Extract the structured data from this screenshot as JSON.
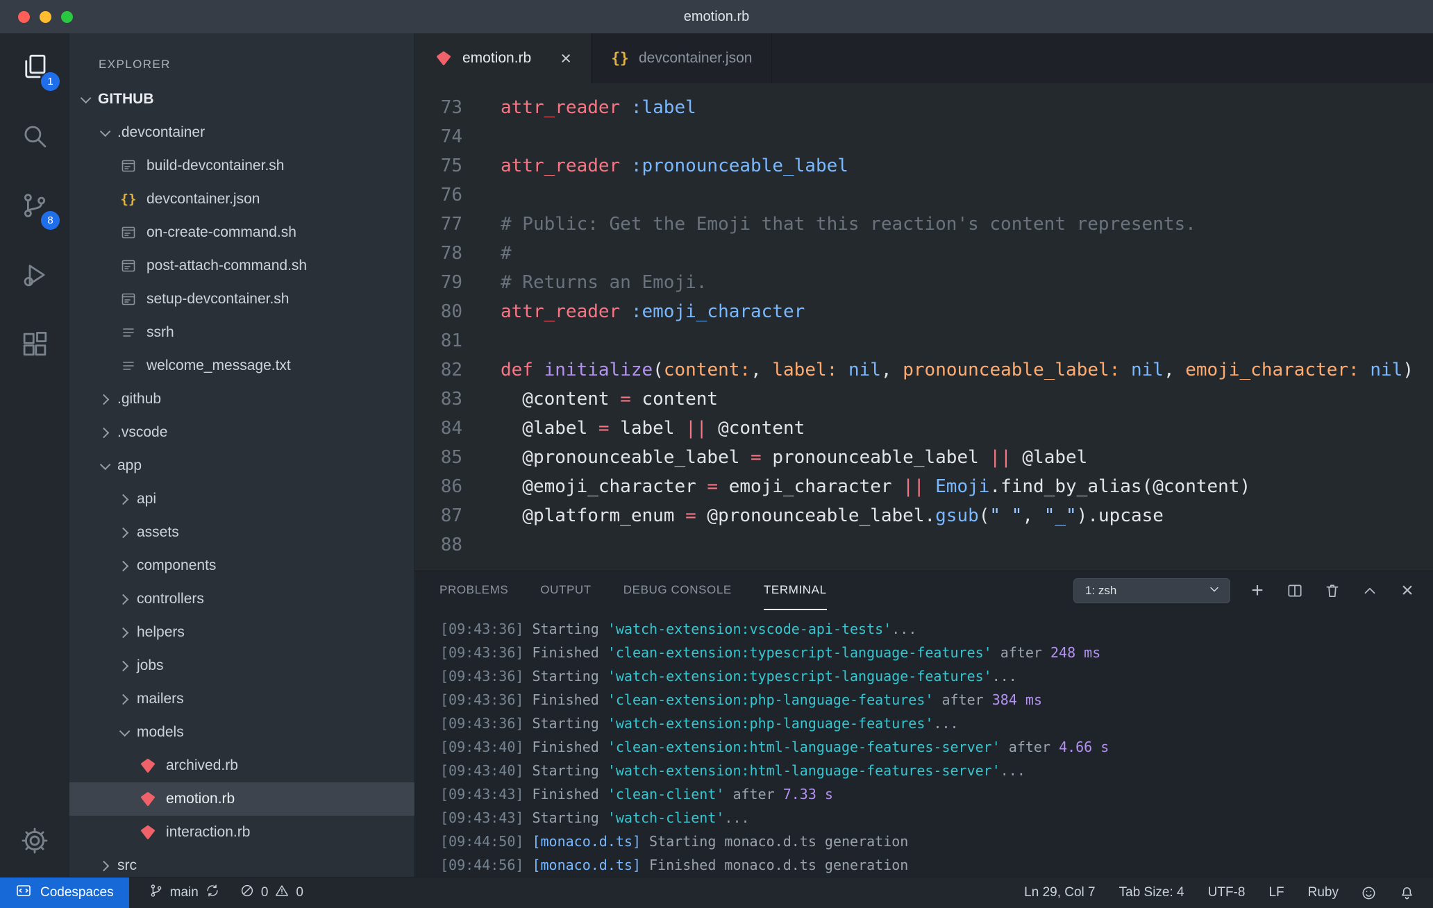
{
  "window": {
    "title": "emotion.rb"
  },
  "activity_bar": {
    "items": [
      {
        "id": "explorer",
        "badge": "1",
        "active": true
      },
      {
        "id": "search",
        "active": false
      },
      {
        "id": "source-control",
        "badge": "8",
        "active": false
      },
      {
        "id": "run-debug",
        "active": false
      },
      {
        "id": "extensions",
        "active": false
      }
    ],
    "settings_label": "settings"
  },
  "sidebar": {
    "header": "EXPLORER",
    "tree": [
      {
        "label": "GITHUB",
        "type": "root",
        "state": "expanded",
        "indent": 0
      },
      {
        "label": ".devcontainer",
        "type": "folder",
        "state": "expanded",
        "indent": 1
      },
      {
        "label": "build-devcontainer.sh",
        "type": "file",
        "icon": "shell",
        "indent": 2
      },
      {
        "label": "devcontainer.json",
        "type": "file",
        "icon": "json",
        "indent": 2
      },
      {
        "label": "on-create-command.sh",
        "type": "file",
        "icon": "shell",
        "indent": 2
      },
      {
        "label": "post-attach-command.sh",
        "type": "file",
        "icon": "shell",
        "indent": 2
      },
      {
        "label": "setup-devcontainer.sh",
        "type": "file",
        "icon": "shell",
        "indent": 2
      },
      {
        "label": "ssrh",
        "type": "file",
        "icon": "text",
        "indent": 2
      },
      {
        "label": "welcome_message.txt",
        "type": "file",
        "icon": "text",
        "indent": 2
      },
      {
        "label": ".github",
        "type": "folder",
        "state": "collapsed",
        "indent": 1
      },
      {
        "label": ".vscode",
        "type": "folder",
        "state": "collapsed",
        "indent": 1
      },
      {
        "label": "app",
        "type": "folder",
        "state": "expanded",
        "indent": 1
      },
      {
        "label": "api",
        "type": "folder",
        "state": "collapsed",
        "indent": 2
      },
      {
        "label": "assets",
        "type": "folder",
        "state": "collapsed",
        "indent": 2
      },
      {
        "label": "components",
        "type": "folder",
        "state": "collapsed",
        "indent": 2
      },
      {
        "label": "controllers",
        "type": "folder",
        "state": "collapsed",
        "indent": 2
      },
      {
        "label": "helpers",
        "type": "folder",
        "state": "collapsed",
        "indent": 2
      },
      {
        "label": "jobs",
        "type": "folder",
        "state": "collapsed",
        "indent": 2
      },
      {
        "label": "mailers",
        "type": "folder",
        "state": "collapsed",
        "indent": 2
      },
      {
        "label": "models",
        "type": "folder",
        "state": "expanded",
        "indent": 2
      },
      {
        "label": "archived.rb",
        "type": "file",
        "icon": "ruby",
        "indent": 3
      },
      {
        "label": "emotion.rb",
        "type": "file",
        "icon": "ruby",
        "indent": 3,
        "selected": true
      },
      {
        "label": "interaction.rb",
        "type": "file",
        "icon": "ruby",
        "indent": 3
      },
      {
        "label": "src",
        "type": "folder",
        "state": "collapsed",
        "indent": 1
      }
    ]
  },
  "tabs": [
    {
      "label": "emotion.rb",
      "icon": "ruby",
      "active": true,
      "close": "×"
    },
    {
      "label": "devcontainer.json",
      "icon": "json",
      "active": false
    }
  ],
  "editor": {
    "lines": [
      {
        "n": "73",
        "segs": [
          [
            "attr_reader",
            "r"
          ],
          [
            " ",
            "t"
          ],
          [
            ":label",
            "b"
          ]
        ]
      },
      {
        "n": "74",
        "segs": []
      },
      {
        "n": "75",
        "segs": [
          [
            "attr_reader",
            "r"
          ],
          [
            " ",
            "t"
          ],
          [
            ":pronounceable_label",
            "b"
          ]
        ]
      },
      {
        "n": "76",
        "segs": []
      },
      {
        "n": "77",
        "segs": [
          [
            "# Public: Get the Emoji that this reaction's content represents.",
            "c"
          ]
        ]
      },
      {
        "n": "78",
        "segs": [
          [
            "#",
            "c"
          ]
        ]
      },
      {
        "n": "79",
        "segs": [
          [
            "# Returns an Emoji.",
            "c"
          ]
        ]
      },
      {
        "n": "80",
        "segs": [
          [
            "attr_reader",
            "r"
          ],
          [
            " ",
            "t"
          ],
          [
            ":emoji_character",
            "b"
          ]
        ]
      },
      {
        "n": "81",
        "segs": []
      },
      {
        "n": "82",
        "segs": [
          [
            "def",
            "r"
          ],
          [
            " ",
            "t"
          ],
          [
            "initialize",
            "p"
          ],
          [
            "(",
            "t"
          ],
          [
            "content:",
            "o"
          ],
          [
            ", ",
            "t"
          ],
          [
            "label:",
            "o"
          ],
          [
            " ",
            "t"
          ],
          [
            "nil",
            "b"
          ],
          [
            ", ",
            "t"
          ],
          [
            "pronounceable_label:",
            "o"
          ],
          [
            " ",
            "t"
          ],
          [
            "nil",
            "b"
          ],
          [
            ", ",
            "t"
          ],
          [
            "emoji_character:",
            "o"
          ],
          [
            " ",
            "t"
          ],
          [
            "nil",
            "b"
          ],
          [
            ")",
            "t"
          ]
        ]
      },
      {
        "n": "83",
        "segs": [
          [
            "  @content ",
            "t"
          ],
          [
            "=",
            "r"
          ],
          [
            " content",
            "t"
          ]
        ]
      },
      {
        "n": "84",
        "segs": [
          [
            "  @label ",
            "t"
          ],
          [
            "=",
            "r"
          ],
          [
            " label ",
            "t"
          ],
          [
            "||",
            "r"
          ],
          [
            " @content",
            "t"
          ]
        ]
      },
      {
        "n": "85",
        "segs": [
          [
            "  @pronounceable_label ",
            "t"
          ],
          [
            "=",
            "r"
          ],
          [
            " pronounceable_label ",
            "t"
          ],
          [
            "||",
            "r"
          ],
          [
            " @label",
            "t"
          ]
        ]
      },
      {
        "n": "86",
        "segs": [
          [
            "  @emoji_character ",
            "t"
          ],
          [
            "=",
            "r"
          ],
          [
            " emoji_character ",
            "t"
          ],
          [
            "||",
            "r"
          ],
          [
            " ",
            "t"
          ],
          [
            "Emoji",
            "b"
          ],
          [
            ".find_by_alias(@content)",
            "t"
          ]
        ]
      },
      {
        "n": "87",
        "segs": [
          [
            "  @platform_enum ",
            "t"
          ],
          [
            "=",
            "r"
          ],
          [
            " @pronounceable_label.",
            "t"
          ],
          [
            "gsub",
            "b"
          ],
          [
            "(",
            "t"
          ],
          [
            "\" \"",
            "s"
          ],
          [
            ", ",
            "t"
          ],
          [
            "\"_\"",
            "s"
          ],
          [
            ")",
            "t"
          ],
          [
            ".upcase",
            "t"
          ]
        ]
      },
      {
        "n": "88",
        "segs": []
      }
    ]
  },
  "panel": {
    "tabs": [
      {
        "label": "PROBLEMS",
        "active": false
      },
      {
        "label": "OUTPUT",
        "active": false
      },
      {
        "label": "DEBUG CONSOLE",
        "active": false
      },
      {
        "label": "TERMINAL",
        "active": true
      }
    ],
    "terminal_selector": "1: zsh",
    "terminal_lines": [
      {
        "segs": [
          [
            "[09:43:36] ",
            "ts"
          ],
          [
            "Starting ",
            "t"
          ],
          [
            "'watch-extension:vscode-api-tests'",
            "cy"
          ],
          [
            "...",
            "t"
          ]
        ]
      },
      {
        "segs": [
          [
            "[09:43:36] ",
            "ts"
          ],
          [
            "Finished ",
            "t"
          ],
          [
            "'clean-extension:typescript-language-features'",
            "cy"
          ],
          [
            " after ",
            "t"
          ],
          [
            "248 ms",
            "pu"
          ]
        ]
      },
      {
        "segs": [
          [
            "[09:43:36] ",
            "ts"
          ],
          [
            "Starting ",
            "t"
          ],
          [
            "'watch-extension:typescript-language-features'",
            "cy"
          ],
          [
            "...",
            "t"
          ]
        ]
      },
      {
        "segs": [
          [
            "[09:43:36] ",
            "ts"
          ],
          [
            "Finished ",
            "t"
          ],
          [
            "'clean-extension:php-language-features'",
            "cy"
          ],
          [
            " after ",
            "t"
          ],
          [
            "384 ms",
            "pu"
          ]
        ]
      },
      {
        "segs": [
          [
            "[09:43:36] ",
            "ts"
          ],
          [
            "Starting ",
            "t"
          ],
          [
            "'watch-extension:php-language-features'",
            "cy"
          ],
          [
            "...",
            "t"
          ]
        ]
      },
      {
        "segs": [
          [
            "[09:43:40] ",
            "ts"
          ],
          [
            "Finished ",
            "t"
          ],
          [
            "'clean-extension:html-language-features-server'",
            "cy"
          ],
          [
            " after ",
            "t"
          ],
          [
            "4.66 s",
            "pu"
          ]
        ]
      },
      {
        "segs": [
          [
            "[09:43:40] ",
            "ts"
          ],
          [
            "Starting ",
            "t"
          ],
          [
            "'watch-extension:html-language-features-server'",
            "cy"
          ],
          [
            "...",
            "t"
          ]
        ]
      },
      {
        "segs": [
          [
            "[09:43:43] ",
            "ts"
          ],
          [
            "Finished ",
            "t"
          ],
          [
            "'clean-client'",
            "cy"
          ],
          [
            " after ",
            "t"
          ],
          [
            "7.33 s",
            "pu"
          ]
        ]
      },
      {
        "segs": [
          [
            "[09:43:43] ",
            "ts"
          ],
          [
            "Starting ",
            "t"
          ],
          [
            "'watch-client'",
            "cy"
          ],
          [
            "...",
            "t"
          ]
        ]
      },
      {
        "segs": [
          [
            "[09:44:50] ",
            "ts"
          ],
          [
            "[monaco.d.ts]",
            "bl"
          ],
          [
            " Starting monaco.d.ts generation",
            "t"
          ]
        ]
      },
      {
        "segs": [
          [
            "[09:44:56] ",
            "ts"
          ],
          [
            "[monaco.d.ts]",
            "bl"
          ],
          [
            " Finished monaco.d.ts generation",
            "t"
          ]
        ]
      }
    ]
  },
  "status_bar": {
    "codespaces": "Codespaces",
    "branch": "main",
    "errors": "0",
    "warnings": "0",
    "right_items": [
      "Ln 29, Col 7",
      "Tab Size: 4",
      "UTF-8",
      "LF",
      "Ruby"
    ]
  },
  "colors": {
    "badge_blue": "#1f6feb",
    "codespaces_blue": "#1669d6",
    "ruby_icon": "#f0626a",
    "json_icon": "#e3b341",
    "terminal_cyan": "#39c5cf",
    "terminal_purple": "#b392f0",
    "keyword_red": "#f97583",
    "symbol_blue": "#79b8ff",
    "function_purple": "#b392f0",
    "param_orange": "#ffab70",
    "comment_gray": "#6a737d",
    "string_blue": "#9ecbff"
  }
}
